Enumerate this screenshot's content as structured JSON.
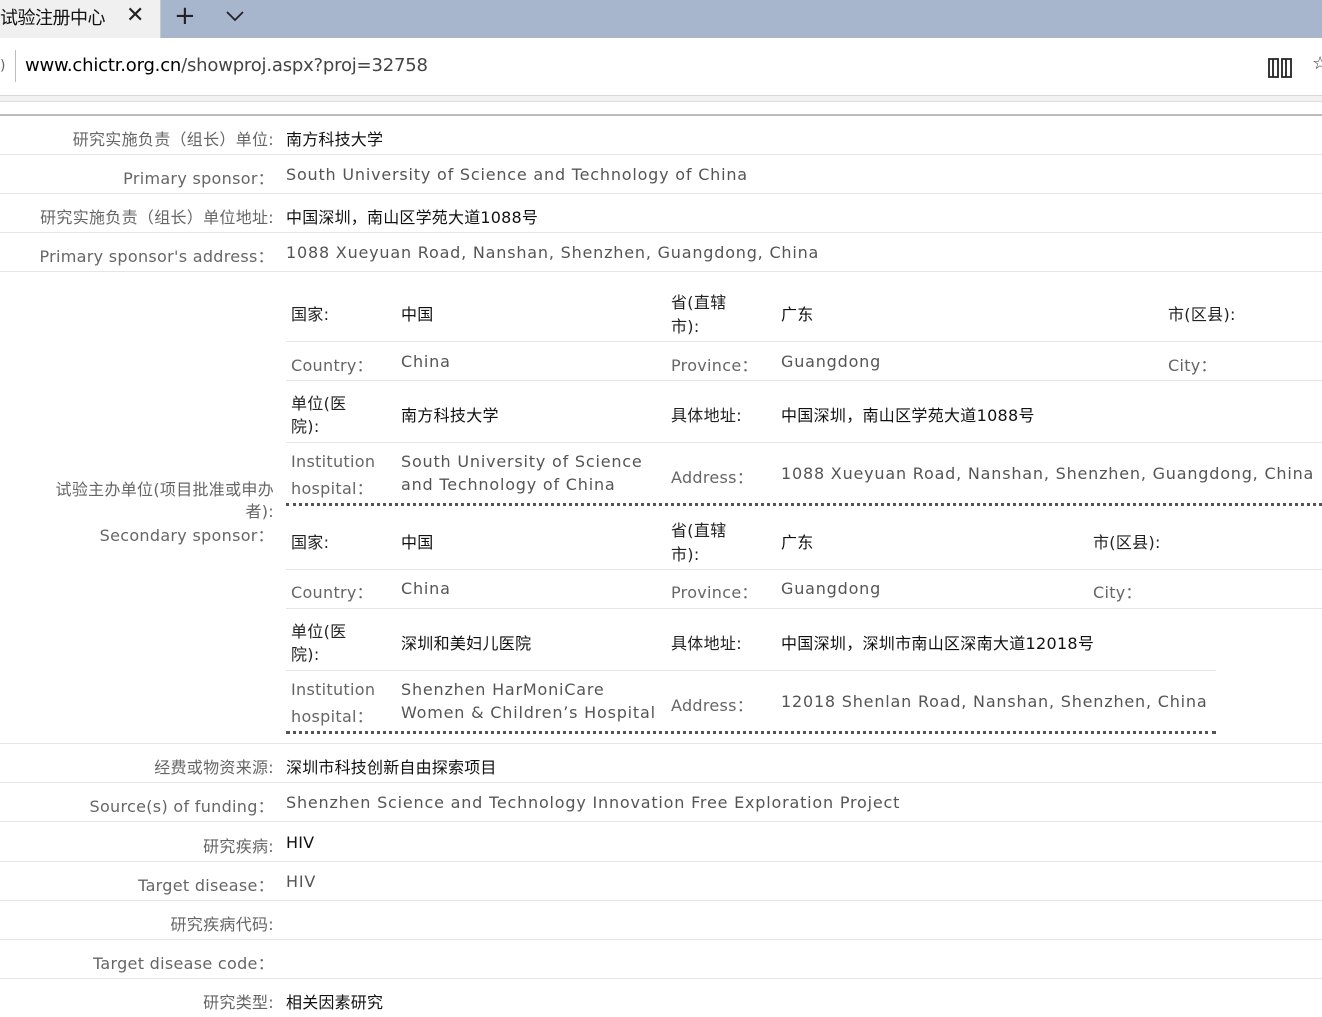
{
  "browser": {
    "tab_title": "试验注册中心",
    "url_domain": "www.chictr.org.cn",
    "url_path": "/showproj.aspx?proj=32758"
  },
  "fields": {
    "sponsor_cn_label": "研究实施负责（组长）单位:",
    "sponsor_cn_value": "南方科技大学",
    "sponsor_en_label": "Primary sponsor：",
    "sponsor_en_value": "South University of Science and Technology of China",
    "sponsor_addr_cn_label": "研究实施负责（组长）单位地址:",
    "sponsor_addr_cn_value": "中国深圳，南山区学苑大道1088号",
    "sponsor_addr_en_label": "Primary sponsor's address：",
    "sponsor_addr_en_value": "1088 Xueyuan Road, Nanshan, Shenzhen, Guangdong, China",
    "secondary_label_cn_1": "试验主办单位(项目批准或申办",
    "secondary_label_cn_2": "者):",
    "secondary_label_en": "Secondary sponsor：",
    "funding_cn_label": "经费或物资来源:",
    "funding_cn_value": "深圳市科技创新自由探索项目",
    "funding_en_label": "Source(s) of funding：",
    "funding_en_value": "Shenzhen Science and Technology Innovation Free Exploration Project",
    "disease_cn_label": "研究疾病:",
    "disease_cn_value": "HIV",
    "disease_en_label": "Target disease：",
    "disease_en_value": "HIV",
    "disease_code_cn_label": "研究疾病代码:",
    "disease_code_en_label": "Target disease code：",
    "study_type_cn_label": "研究类型:",
    "study_type_cn_value": "相关因素研究"
  },
  "sub_labels": {
    "country_cn": "国家:",
    "province_cn_1": "省(直辖",
    "province_cn_2": "市):",
    "city_cn": "市(区县):",
    "country_en": "Country：",
    "province_en": "Province：",
    "city_en": "City：",
    "unit_cn_1": "单位(医",
    "unit_cn_2": "院):",
    "address_cn": "具体地址:",
    "institution_en_1": "Institution",
    "institution_en_2": "hospital：",
    "address_en": "Address："
  },
  "secondary_sponsors": [
    {
      "country_cn": "中国",
      "province_cn": "广东",
      "country_en": "China",
      "province_en": "Guangdong",
      "unit_cn": "南方科技大学",
      "address_cn": "中国深圳，南山区学苑大道1088号",
      "institution_en_1": "South University of Science",
      "institution_en_2": "and Technology of China",
      "address_en": "1088 Xueyuan Road, Nanshan, Shenzhen, Guangdong, China"
    },
    {
      "country_cn": "中国",
      "province_cn": "广东",
      "country_en": "China",
      "province_en": "Guangdong",
      "unit_cn": "深圳和美妇儿医院",
      "address_cn": "中国深圳，深圳市南山区深南大道12018号",
      "institution_en_1": "Shenzhen HarMoniCare",
      "institution_en_2": "Women & Children’s Hospital",
      "address_en": "12018 Shenlan Road, Nanshan, Shenzhen, China"
    }
  ]
}
